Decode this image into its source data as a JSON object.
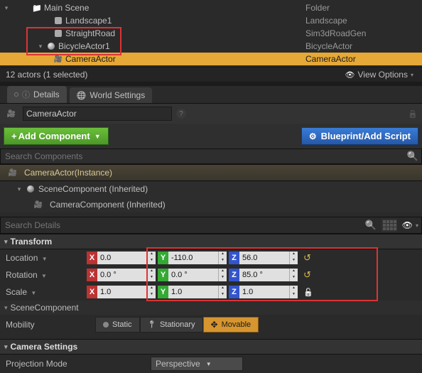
{
  "outliner": {
    "rows": [
      {
        "label": "Main Scene",
        "type": "Folder"
      },
      {
        "label": "Landscape1",
        "type": "Landscape"
      },
      {
        "label": "StraightRoad",
        "type": "Sim3dRoadGen"
      },
      {
        "label": "BicycleActor1",
        "type": "BicycleActor"
      },
      {
        "label": "CameraActor",
        "type": "CameraActor"
      }
    ],
    "footer": "12 actors (1 selected)",
    "view_options": "View Options"
  },
  "tabs": {
    "details": "Details",
    "world": "World Settings"
  },
  "actor_name": "CameraActor",
  "add_component": "Add Component",
  "blueprint_btn": "Blueprint/Add Script",
  "search_components_placeholder": "Search Components",
  "component_header": "CameraActor(Instance)",
  "components": [
    "SceneComponent (Inherited)",
    "CameraComponent (Inherited)"
  ],
  "search_details_placeholder": "Search Details",
  "transform": {
    "title": "Transform",
    "location_label": "Location",
    "rotation_label": "Rotation",
    "scale_label": "Scale",
    "location": {
      "x": "0.0",
      "y": "-110.0",
      "z": "56.0"
    },
    "rotation": {
      "x": "0.0 °",
      "y": "0.0 °",
      "z": "85.0 °"
    },
    "scale": {
      "x": "1.0",
      "y": "1.0",
      "z": "1.0"
    }
  },
  "scene_component_label": "SceneComponent",
  "mobility": {
    "label": "Mobility",
    "static": "Static",
    "stationary": "Stationary",
    "movable": "Movable"
  },
  "camera_settings": {
    "title": "Camera Settings",
    "projection_label": "Projection Mode",
    "projection_value": "Perspective"
  }
}
